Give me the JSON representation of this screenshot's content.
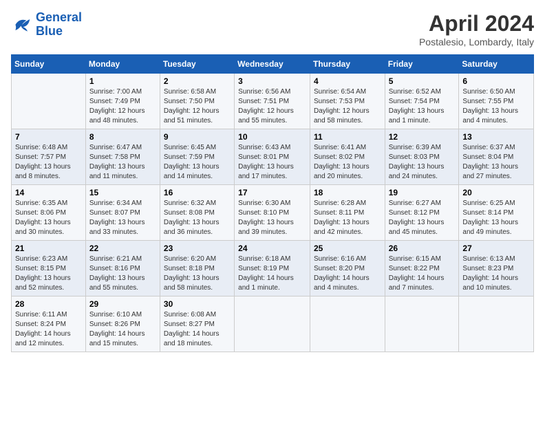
{
  "logo": {
    "line1": "General",
    "line2": "Blue"
  },
  "title": "April 2024",
  "location": "Postalesio, Lombardy, Italy",
  "days_of_week": [
    "Sunday",
    "Monday",
    "Tuesday",
    "Wednesday",
    "Thursday",
    "Friday",
    "Saturday"
  ],
  "weeks": [
    [
      {
        "day": "",
        "info": ""
      },
      {
        "day": "1",
        "info": "Sunrise: 7:00 AM\nSunset: 7:49 PM\nDaylight: 12 hours\nand 48 minutes."
      },
      {
        "day": "2",
        "info": "Sunrise: 6:58 AM\nSunset: 7:50 PM\nDaylight: 12 hours\nand 51 minutes."
      },
      {
        "day": "3",
        "info": "Sunrise: 6:56 AM\nSunset: 7:51 PM\nDaylight: 12 hours\nand 55 minutes."
      },
      {
        "day": "4",
        "info": "Sunrise: 6:54 AM\nSunset: 7:53 PM\nDaylight: 12 hours\nand 58 minutes."
      },
      {
        "day": "5",
        "info": "Sunrise: 6:52 AM\nSunset: 7:54 PM\nDaylight: 13 hours\nand 1 minute."
      },
      {
        "day": "6",
        "info": "Sunrise: 6:50 AM\nSunset: 7:55 PM\nDaylight: 13 hours\nand 4 minutes."
      }
    ],
    [
      {
        "day": "7",
        "info": "Sunrise: 6:48 AM\nSunset: 7:57 PM\nDaylight: 13 hours\nand 8 minutes."
      },
      {
        "day": "8",
        "info": "Sunrise: 6:47 AM\nSunset: 7:58 PM\nDaylight: 13 hours\nand 11 minutes."
      },
      {
        "day": "9",
        "info": "Sunrise: 6:45 AM\nSunset: 7:59 PM\nDaylight: 13 hours\nand 14 minutes."
      },
      {
        "day": "10",
        "info": "Sunrise: 6:43 AM\nSunset: 8:01 PM\nDaylight: 13 hours\nand 17 minutes."
      },
      {
        "day": "11",
        "info": "Sunrise: 6:41 AM\nSunset: 8:02 PM\nDaylight: 13 hours\nand 20 minutes."
      },
      {
        "day": "12",
        "info": "Sunrise: 6:39 AM\nSunset: 8:03 PM\nDaylight: 13 hours\nand 24 minutes."
      },
      {
        "day": "13",
        "info": "Sunrise: 6:37 AM\nSunset: 8:04 PM\nDaylight: 13 hours\nand 27 minutes."
      }
    ],
    [
      {
        "day": "14",
        "info": "Sunrise: 6:35 AM\nSunset: 8:06 PM\nDaylight: 13 hours\nand 30 minutes."
      },
      {
        "day": "15",
        "info": "Sunrise: 6:34 AM\nSunset: 8:07 PM\nDaylight: 13 hours\nand 33 minutes."
      },
      {
        "day": "16",
        "info": "Sunrise: 6:32 AM\nSunset: 8:08 PM\nDaylight: 13 hours\nand 36 minutes."
      },
      {
        "day": "17",
        "info": "Sunrise: 6:30 AM\nSunset: 8:10 PM\nDaylight: 13 hours\nand 39 minutes."
      },
      {
        "day": "18",
        "info": "Sunrise: 6:28 AM\nSunset: 8:11 PM\nDaylight: 13 hours\nand 42 minutes."
      },
      {
        "day": "19",
        "info": "Sunrise: 6:27 AM\nSunset: 8:12 PM\nDaylight: 13 hours\nand 45 minutes."
      },
      {
        "day": "20",
        "info": "Sunrise: 6:25 AM\nSunset: 8:14 PM\nDaylight: 13 hours\nand 49 minutes."
      }
    ],
    [
      {
        "day": "21",
        "info": "Sunrise: 6:23 AM\nSunset: 8:15 PM\nDaylight: 13 hours\nand 52 minutes."
      },
      {
        "day": "22",
        "info": "Sunrise: 6:21 AM\nSunset: 8:16 PM\nDaylight: 13 hours\nand 55 minutes."
      },
      {
        "day": "23",
        "info": "Sunrise: 6:20 AM\nSunset: 8:18 PM\nDaylight: 13 hours\nand 58 minutes."
      },
      {
        "day": "24",
        "info": "Sunrise: 6:18 AM\nSunset: 8:19 PM\nDaylight: 14 hours\nand 1 minute."
      },
      {
        "day": "25",
        "info": "Sunrise: 6:16 AM\nSunset: 8:20 PM\nDaylight: 14 hours\nand 4 minutes."
      },
      {
        "day": "26",
        "info": "Sunrise: 6:15 AM\nSunset: 8:22 PM\nDaylight: 14 hours\nand 7 minutes."
      },
      {
        "day": "27",
        "info": "Sunrise: 6:13 AM\nSunset: 8:23 PM\nDaylight: 14 hours\nand 10 minutes."
      }
    ],
    [
      {
        "day": "28",
        "info": "Sunrise: 6:11 AM\nSunset: 8:24 PM\nDaylight: 14 hours\nand 12 minutes."
      },
      {
        "day": "29",
        "info": "Sunrise: 6:10 AM\nSunset: 8:26 PM\nDaylight: 14 hours\nand 15 minutes."
      },
      {
        "day": "30",
        "info": "Sunrise: 6:08 AM\nSunset: 8:27 PM\nDaylight: 14 hours\nand 18 minutes."
      },
      {
        "day": "",
        "info": ""
      },
      {
        "day": "",
        "info": ""
      },
      {
        "day": "",
        "info": ""
      },
      {
        "day": "",
        "info": ""
      }
    ]
  ]
}
